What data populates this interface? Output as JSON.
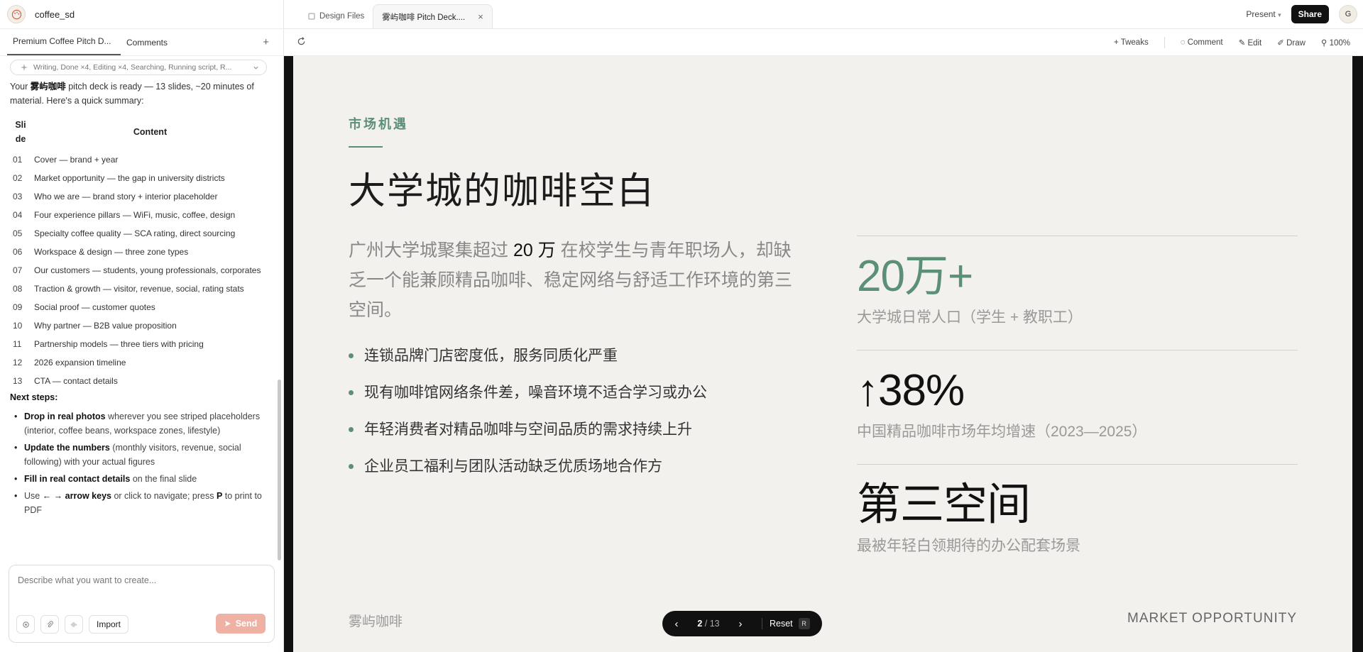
{
  "project": {
    "name": "coffee_sd"
  },
  "left_tabs": [
    {
      "label": "Premium Coffee Pitch D..."
    },
    {
      "label": "Comments"
    }
  ],
  "status_pill": "Writing, Done ×4, Editing ×4, Searching, Running script, R...",
  "intro": {
    "before": "Your ",
    "brand": "雾屿咖啡",
    "after": " pitch deck is ready — 13 slides, ~20 minutes of material. Here's a quick summary:"
  },
  "table": {
    "headers": {
      "slide": "Slide",
      "content": "Content"
    },
    "rows": [
      {
        "n": "01",
        "c": "Cover — brand + year"
      },
      {
        "n": "02",
        "c": "Market opportunity — the gap in university districts"
      },
      {
        "n": "03",
        "c": "Who we are — brand story + interior placeholder"
      },
      {
        "n": "04",
        "c": "Four experience pillars — WiFi, music, coffee, design"
      },
      {
        "n": "05",
        "c": "Specialty coffee quality — SCA rating, direct sourcing"
      },
      {
        "n": "06",
        "c": "Workspace & design — three zone types"
      },
      {
        "n": "07",
        "c": "Our customers — students, young professionals, corporates"
      },
      {
        "n": "08",
        "c": "Traction & growth — visitor, revenue, social, rating stats"
      },
      {
        "n": "09",
        "c": "Social proof — customer quotes"
      },
      {
        "n": "10",
        "c": "Why partner — B2B value proposition"
      },
      {
        "n": "11",
        "c": "Partnership models — three tiers with pricing"
      },
      {
        "n": "12",
        "c": "2026 expansion timeline"
      },
      {
        "n": "13",
        "c": "CTA — contact details"
      }
    ]
  },
  "next_steps": {
    "heading": "Next steps:",
    "items": [
      {
        "bold": "Drop in real photos",
        "rest": " wherever you see striped placeholders (interior, coffee beans, workspace zones, lifestyle)"
      },
      {
        "bold": "Update the numbers",
        "rest": " (monthly visitors, revenue, social following) with your actual figures"
      },
      {
        "bold": "Fill in real contact details",
        "rest": " on the final slide"
      },
      {
        "pre": "Use ",
        "bold": "← → arrow keys",
        "rest": " or click to navigate; press ",
        "bold2": "P",
        "rest2": " to print to PDF"
      }
    ]
  },
  "composer": {
    "placeholder": "Describe what you want to create...",
    "import_label": "Import",
    "send_label": "Send"
  },
  "file_tabs": [
    {
      "label": "Design Files"
    },
    {
      "label": "雾屿咖啡 Pitch Deck...."
    }
  ],
  "topbar": {
    "present": "Present",
    "share": "Share",
    "avatar": "G"
  },
  "tools": {
    "tweaks": "Tweaks",
    "comment": "Comment",
    "edit": "Edit",
    "draw": "Draw",
    "zoom": "100%"
  },
  "slide": {
    "kicker": "市场机遇",
    "title": "大学城的咖啡空白",
    "lead_before": "广州大学城聚集超过 ",
    "lead_highlight": "20 万",
    "lead_after": " 在校学生与青年职场人，却缺乏一个能兼顾精品咖啡、稳定网络与舒适工作环境的第三空间。",
    "bullets": [
      "连锁品牌门店密度低，服务同质化严重",
      "现有咖啡馆网络条件差，噪音环境不适合学习或办公",
      "年轻消费者对精品咖啡与空间品质的需求持续上升",
      "企业员工福利与团队活动缺乏优质场地合作方"
    ],
    "stats": [
      {
        "value": "20万+",
        "caption": "大学城日常人口（学生 + 教职工）"
      },
      {
        "value": "↑38%",
        "caption": "中国精品咖啡市场年均增速（2023—2025）"
      },
      {
        "value": "第三空间",
        "caption": "最被年轻白领期待的办公配套场景"
      }
    ],
    "brand": "雾屿咖啡",
    "section": "MARKET OPPORTUNITY"
  },
  "pager": {
    "current": "2",
    "total": "/ 13",
    "reset": "Reset",
    "key": "R"
  },
  "colors": {
    "accent": "#5b8f76",
    "slide_bg": "#f3f1ed",
    "send": "#efb1a4"
  }
}
